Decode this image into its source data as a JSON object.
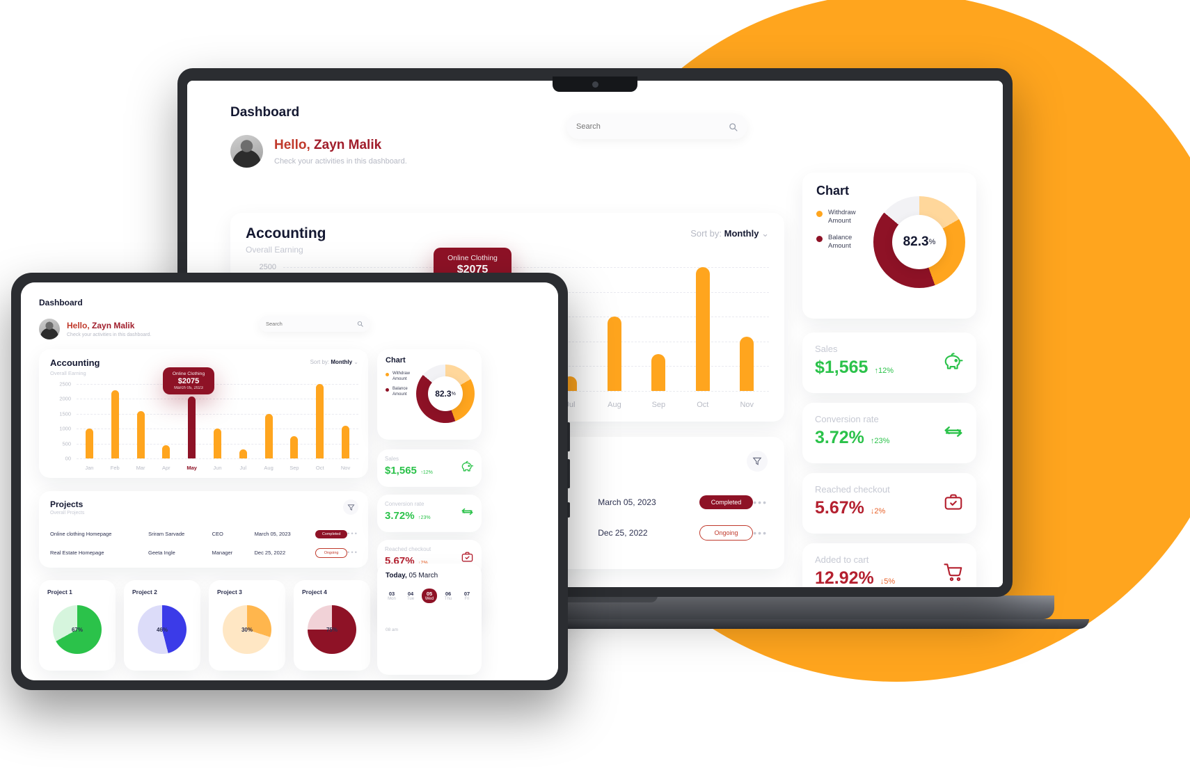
{
  "theme": {
    "orange": "#FFA51E",
    "crimson": "#8E1226",
    "red": "#C0392B",
    "green": "#2BC24A",
    "ink": "#141831",
    "muted": "#c6c9d3"
  },
  "backdrop": {
    "shape": "orange-circle"
  },
  "header": {
    "title": "Dashboard"
  },
  "greeting": {
    "hello_prefix": "Hello, ",
    "user_name": "Zayn Malik",
    "subtitle": "Check your activities in this dashboard.",
    "avatar_alt": "user-avatar"
  },
  "search": {
    "placeholder": "Search",
    "icon": "search-icon"
  },
  "accounting": {
    "title": "Accounting",
    "subtitle": "Overall Earning",
    "sort_label": "Sort by:",
    "sort_value": "Monthly",
    "sort_caret": "⌄",
    "tooltip": {
      "name": "Online Clothing",
      "value": "$2075",
      "date": "March 05, 2023"
    }
  },
  "chart_data": {
    "type": "bar",
    "title": "Accounting — Overall Earning",
    "xlabel": "",
    "ylabel": "",
    "ylim": [
      0,
      2500
    ],
    "grid": true,
    "legend_position": "none",
    "yticks": [
      2500,
      2000,
      1500,
      1000,
      500,
      0
    ],
    "ytick_labels": [
      "2500",
      "2000",
      "1500",
      "1000",
      "500",
      "00"
    ],
    "categories": [
      "Jan",
      "Feb",
      "Mar",
      "Apr",
      "May",
      "Jun",
      "Jul",
      "Aug",
      "Sep",
      "Oct",
      "Nov"
    ],
    "values": [
      1000,
      2300,
      1600,
      450,
      2075,
      1000,
      300,
      1500,
      750,
      2500,
      1100
    ],
    "highlight_index": 4,
    "bar_color": "#FFA51E",
    "highlight_color": "#8E1226",
    "annotation": {
      "category": "May",
      "label": "Online Clothing",
      "value": "$2075",
      "date": "March 05, 2023"
    }
  },
  "donut_card": {
    "title": "Chart",
    "center_value": "82.3",
    "center_unit": "%",
    "legend": [
      {
        "label_line1": "Withdraw",
        "label_line2": "Amount",
        "color": "#FFA51E"
      },
      {
        "label_line1": "Balance",
        "label_line2": "Amount",
        "color": "#8E1226"
      }
    ],
    "donut_chart": {
      "type": "pie",
      "labels": [
        "Withdraw Amount",
        "Balance Amount",
        "Remainder"
      ],
      "values": [
        30,
        42,
        28
      ],
      "colors": [
        "#FFA51E",
        "#8E1226",
        "#FFD79B"
      ]
    }
  },
  "stats": [
    {
      "label": "Sales",
      "value": "$1,565",
      "trend": "up",
      "delta": "12%",
      "arrow": "↑",
      "icon": "piggy-bank-icon"
    },
    {
      "label": "Conversion rate",
      "value": "3.72%",
      "trend": "up",
      "delta": "23%",
      "arrow": "↑",
      "icon": "exchange-arrows-icon"
    },
    {
      "label": "Reached checkout",
      "value": "5.67%",
      "trend": "down",
      "delta": "2%",
      "arrow": "↓",
      "icon": "briefcase-check-icon"
    },
    {
      "label": "Added to cart",
      "value": "12.92%",
      "trend": "down",
      "delta": "5%",
      "arrow": "↓",
      "icon": "shopping-cart-icon"
    }
  ],
  "projects": {
    "title": "Projects",
    "subtitle": "Overall Projects",
    "filter_icon": "filter-icon",
    "menu_icon": "more-options-icon",
    "rows": [
      {
        "name": "Online clothing Homepage",
        "person": "Sriram Sarvade",
        "role": "CEO",
        "date": "March 05, 2023",
        "status": "Completed",
        "status_type": "completed"
      },
      {
        "name": "Real Estate Homepage",
        "person": "Geeta Ingle",
        "role": "Manager",
        "date": "Dec 25, 2022",
        "status": "Ongoing",
        "status_type": "ongoing"
      }
    ]
  },
  "project_cards": [
    {
      "title": "Project 1",
      "percent": "67%",
      "value": 67,
      "color": "#2BC24A",
      "track": "#D6F5DD"
    },
    {
      "title": "Project 2",
      "percent": "46%",
      "value": 46,
      "color": "#3B3BE8",
      "track": "#DCDCF9"
    },
    {
      "title": "Project 3",
      "percent": "30%",
      "value": 30,
      "color": "#FFB64D",
      "track": "#FFE7C4"
    },
    {
      "title": "Project 4",
      "percent": "75%",
      "value": 75,
      "color": "#8E1226",
      "track": "#F1D2D7"
    }
  ],
  "calendar": {
    "today_prefix": "Today, ",
    "today_value": "05 March",
    "time_label": "08 am",
    "days": [
      {
        "num": "03",
        "dow": "Mon",
        "active": false
      },
      {
        "num": "04",
        "dow": "Tue",
        "active": false
      },
      {
        "num": "05",
        "dow": "Wed",
        "active": true
      },
      {
        "num": "06",
        "dow": "Thu",
        "active": false
      },
      {
        "num": "07",
        "dow": "Fri",
        "active": false
      }
    ]
  }
}
